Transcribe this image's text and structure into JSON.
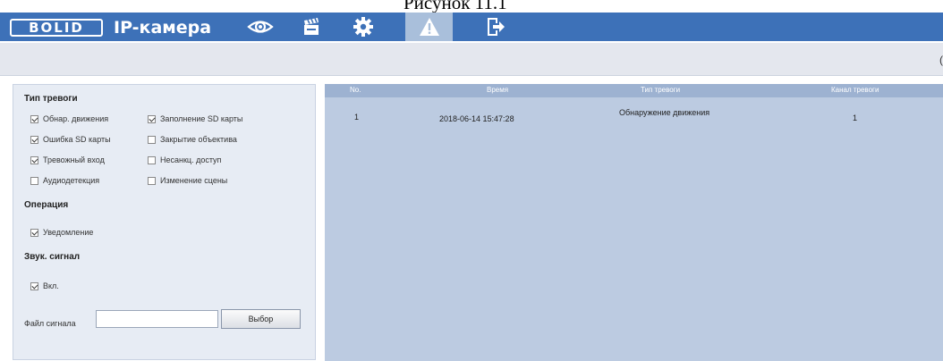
{
  "caption": "Рисунок 11.1",
  "header": {
    "logo": "BOLID",
    "title": "IP-камера",
    "nav": [
      {
        "name": "live-view",
        "icon": "eye-icon"
      },
      {
        "name": "playback",
        "icon": "clapperboard-icon"
      },
      {
        "name": "settings",
        "icon": "gear-icon"
      },
      {
        "name": "alarm",
        "icon": "warning-icon",
        "active": true
      },
      {
        "name": "logout",
        "icon": "exit-icon"
      }
    ],
    "colors": {
      "bar": "#3d71b8",
      "active_tab": "#a9bfdb"
    }
  },
  "subbar": {
    "edge_mark": "("
  },
  "left": {
    "alarm_type_title": "Тип тревоги",
    "alarm_types": [
      {
        "label": "Обнар. движения",
        "checked": true
      },
      {
        "label": "Заполнение SD карты",
        "checked": true
      },
      {
        "label": "Ошибка SD карты",
        "checked": true
      },
      {
        "label": "Закрытие объектива",
        "checked": false
      },
      {
        "label": "Тревожный вход",
        "checked": true
      },
      {
        "label": "Несанкц. доступ",
        "checked": false
      },
      {
        "label": "Аудиодетекция",
        "checked": false
      },
      {
        "label": "Изменение сцены",
        "checked": false
      }
    ],
    "operation_title": "Операция",
    "notify": {
      "label": "Уведомление",
      "checked": true
    },
    "sound_title": "Звук. сигнал",
    "sound_on": {
      "label": "Вкл.",
      "checked": true
    },
    "file_label": "Файл сигнала",
    "file_value": "",
    "browse_label": "Выбор"
  },
  "table": {
    "headers": [
      "No.",
      "Время",
      "Тип тревоги",
      "Канал тревоги"
    ],
    "rows": [
      {
        "no": "1",
        "time": "2018-06-14 15:47:28",
        "type": "Обнаружение движения",
        "channel": "1"
      }
    ]
  }
}
